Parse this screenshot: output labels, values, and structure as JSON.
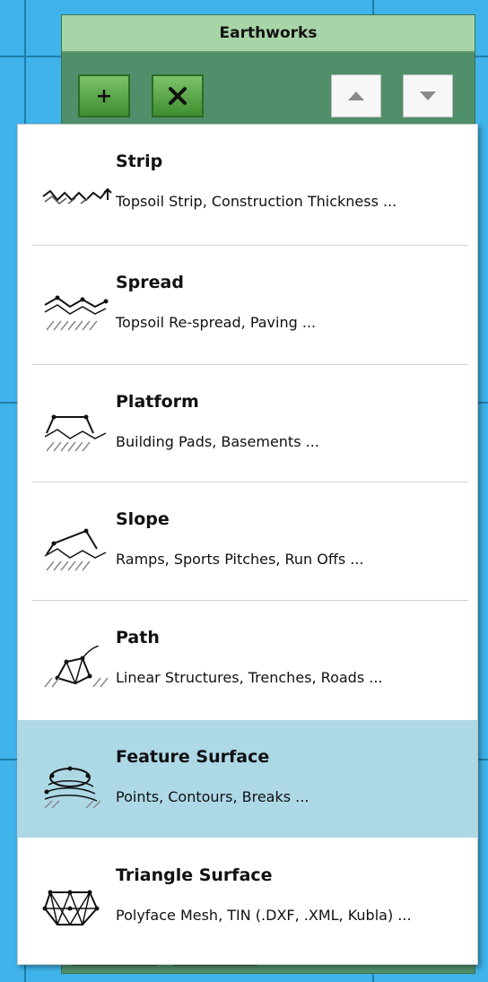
{
  "panel": {
    "title": "Earthworks",
    "add_icon": "plus-icon",
    "delete_icon": "x-icon",
    "up_icon": "arrow-up-icon",
    "down_icon": "arrow-down-icon"
  },
  "menu": {
    "items": [
      {
        "title": "Strip",
        "description": "Topsoil Strip, Construction Thickness ...",
        "icon": "strip-icon",
        "selected": false
      },
      {
        "title": "Spread",
        "description": "Topsoil Re-spread, Paving ...",
        "icon": "spread-icon",
        "selected": false
      },
      {
        "title": "Platform",
        "description": "Building Pads, Basements ...",
        "icon": "platform-icon",
        "selected": false
      },
      {
        "title": "Slope",
        "description": "Ramps, Sports Pitches, Run Offs ...",
        "icon": "slope-icon",
        "selected": false
      },
      {
        "title": "Path",
        "description": "Linear Structures, Trenches, Roads ...",
        "icon": "path-icon",
        "selected": false
      },
      {
        "title": "Feature Surface",
        "description": "Points, Contours, Breaks ...",
        "icon": "feature-surface-icon",
        "selected": true
      },
      {
        "title": "Triangle Surface",
        "description": "Polyface Mesh, TIN (.DXF, .XML, Kubla) ...",
        "icon": "triangle-surface-icon",
        "selected": false
      }
    ]
  },
  "colors": {
    "background": "#3fb3ea",
    "panel": "#4f8f6a",
    "header": "#a8d5a8",
    "selected": "#add8e6"
  }
}
